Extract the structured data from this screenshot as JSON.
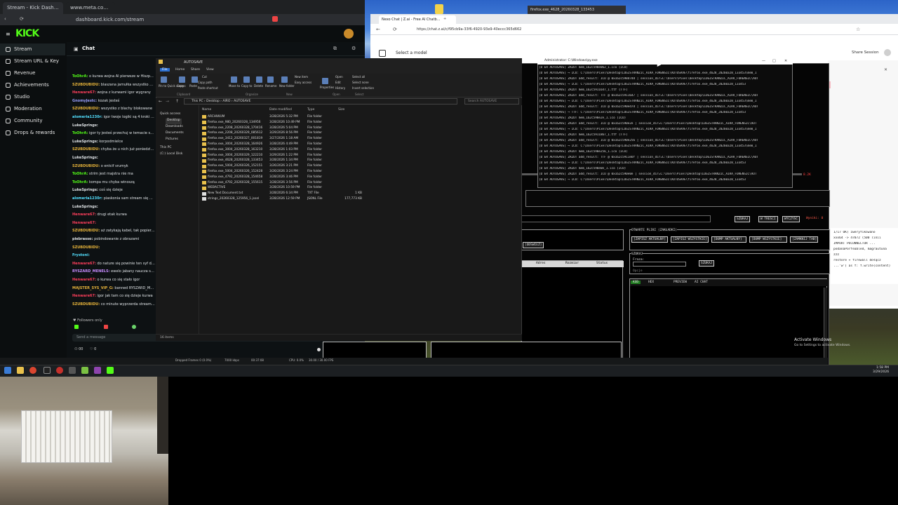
{
  "kick": {
    "tabs": [
      "Stream - Kick Dashboard",
      "www.meta.com/..."
    ],
    "url": "dashboard.kick.com/stream",
    "logo": "KICK",
    "nav": [
      "Stream",
      "Stream URL & Key",
      "Revenue",
      "Achievements",
      "Studio",
      "Moderation",
      "Community",
      "Drops & rewards"
    ],
    "chat_title": "Chat",
    "messages": [
      {
        "user": "ToOhrA:",
        "text": "o kurwa wojna Al pierwsze w Hiszp...",
        "color": "#53fc18"
      },
      {
        "user": "SZUBDUBIDU:",
        "text": "blaszana jamułka wszystko przech...",
        "color": "#e6b33a"
      },
      {
        "user": "Henware67:",
        "text": "wojna z kurwami igor wygrany",
        "color": "#ff3f5c"
      },
      {
        "user": "GnomyJestc:",
        "text": "kozak jesteś",
        "color": "#9aa0ff"
      },
      {
        "user": "SZUBDUBIDU:",
        "text": "wszystko z blachy blokowane",
        "color": "#e6b33a"
      },
      {
        "user": "alomeria1230r:",
        "text": "igor twoje logiki są 4 kroki prze...",
        "color": "#53e0ff"
      },
      {
        "user": "LukeSprings:",
        "text": "",
        "color": "#dfe3e6"
      },
      {
        "user": "ToOhrA:",
        "text": "igor ty jesteś przechuj w temacie s...",
        "color": "#53fc18"
      },
      {
        "user": "LukeSprings:",
        "text": "korpodmielce",
        "color": "#dfe3e6"
      },
      {
        "user": "SZUBDUBIDU:",
        "text": "chyba że u nich już poniedziałek i z...",
        "color": "#e6b33a"
      },
      {
        "user": "LukeSprings:",
        "text": "",
        "color": "#dfe3e6"
      },
      {
        "user": "SZUBDUBIDU:",
        "text": "o entcif srumyk",
        "color": "#e6b33a"
      },
      {
        "user": "ToOhrA:",
        "text": "strim jest majstra nie ma",
        "color": "#53fc18"
      },
      {
        "user": "ToOhrA:",
        "text": "kompa mu chyba winoszą",
        "color": "#53fc18"
      },
      {
        "user": "LukeSprings:",
        "text": "coś się dzieje",
        "color": "#dfe3e6"
      },
      {
        "user": "alomeria1230r:",
        "text": "piaskonia sam stream się wiac",
        "color": "#53e0ff"
      },
      {
        "user": "LukeSprings:",
        "text": "",
        "color": "#dfe3e6"
      },
      {
        "user": "Henware67:",
        "text": "drugi etak kurwa",
        "color": "#ff3f5c"
      },
      {
        "user": "Henware67:",
        "text": "",
        "color": "#ff3f5c"
      },
      {
        "user": "SZUBDUBIDU:",
        "text": "aż zatykają kabel, tak popierdaląś",
        "color": "#e6b33a"
      },
      {
        "user": "piebrasso:",
        "text": "pobindowanie z obrazami",
        "color": "#dfe3e6"
      },
      {
        "user": "SZUBDUBIDU:",
        "text": "",
        "color": "#e6b33a"
      },
      {
        "user": "Frystoni:",
        "text": "",
        "color": "#53e0ff"
      },
      {
        "user": "Henware67:",
        "text": "do nature się powinie ten syf doszał",
        "color": "#ff3f5c"
      },
      {
        "user": "RYSZARD_MENELS:",
        "text": "ewelo jabany naucza się kompu",
        "color": "#c78cff"
      },
      {
        "user": "Henware67:",
        "text": "o kurwa co się stało igor",
        "color": "#ff3f5c"
      },
      {
        "user": "MAJSTER_SYS_VIP_G:",
        "text": "banned RYSZARD_MENEL5",
        "color": "#e6b33a"
      },
      {
        "user": "Henware67:",
        "text": "igor jak tam co się dzieje kurwa",
        "color": "#ff3f5c"
      },
      {
        "user": "SZUBDUBIDU:",
        "text": "co minute wyprzerda streama igor...",
        "color": "#e6b33a"
      }
    ],
    "followers_only": "Followers only",
    "send_placeholder": "Send a message",
    "viewer_count": "00",
    "obs_status": [
      "Dropped Frames 0 (0.0%)",
      "7000 kbps",
      "00:37:08",
      "CPU: 0.0%",
      "30.00 / 30.00 FPS"
    ]
  },
  "ai_browser": {
    "tabs": [
      "Nexo Chat | Z.ai - Free AI Chatb...",
      "firefox.exe_4628_20260328_133453"
    ],
    "url": "https://chat.z.ai/c/f95cb9a-33f6-4920-93e9-40eccc365d662",
    "model_select": "Select a model",
    "share": "Share Session"
  },
  "console": {
    "title": "Administrator: C:\\Windows\\py.exe",
    "lines": [
      "[D ER AUTOSAVE] ZRZUT mem_162c598e062_1.ico (ICO)",
      "[D ER AUTOSAVE] ⟶ ICO: C:\\Users\\Pixel\\Desktop\\LOGISTRANZIC_AIRA_FORENSIC\\AUTOSAVE\\firefox.exe_4628_20260328_133453\\mem_1",
      "[D ER AUTOSAVE] ZRZUT add_result: ICO @ 0x162c598d7dd | session_dir=C:\\Users\\Pixel\\Desktop\\LOGISTRANZIC_AIRA_FORENSIC\\AUT",
      "[D ER AUTOSAVE] ⟶ ICO: C:\\Users\\Pixel\\Desktop\\LOGISTRANZIC_AIRA_FORENSIC\\AUTOSAVE\\firefox.exe_4628_20260328_133453",
      "[D ER AUTOSAVE] ZRZUT mem_162c5911647_1.ttf (TTF)",
      "[D ER AUTOSAVE] ZRZUT add_result: TTF @ 0x162c5911647 | session_dir=C:\\Users\\Pixel\\Desktop\\LOGISTRANZIC_AIRA_FORENSIC\\AUT",
      "[D ER AUTOSAVE] ⟶ ICO: C:\\Users\\Pixel\\Desktop\\LOGISTRANZIC_AIRA_FORENSIC\\AUTOSAVE\\firefox.exe_4628_20260328_133453\\mem_1",
      "[D ER AUTOSAVE] ZRZUT add_result: ICO @ 0x162c590ed7d | session_dir=C:\\Users\\Pixel\\Desktop\\LOGISTRANZIC_AIRA_FORENSIC\\AUT",
      "[D ER AUTOSAVE] ⟶ TTF: C:\\Users\\Pixel\\Desktop\\LOGISTRANZIC_AIRA_FORENSIC\\AUTOSAVE\\firefox.exe_4628_20260328_133453",
      "[D ER AUTOSAVE] ZRZUT mem_162c590e2e_1.ico (ICO)",
      "[D ER AUTOSAVE] ZRZUT add_result: ICO @ 0x162c590e2e | session_dir=C:\\Users\\Pixel\\Desktop\\LOGISTRANZIC_AIRA_FORENSIC\\AUT",
      "[D ER AUTOSAVE] ⟶ ICO: C:\\Users\\Pixel\\Desktop\\LOGISTRANZIC_AIRA_FORENSIC\\AUTOSAVE\\firefox.exe_4628_20260328_133453\\mem_1",
      "[D ER AUTOSAVE] ZRZUT mem_162c5911867_1.ttf (TTF)",
      "[D ER AUTOSAVE] ZRZUT add_result: ICO @ 0x162c590e256 | session_dir=C:\\Users\\Pixel\\Desktop\\LOGISTRANZIC_AIRA_FORENSIC\\AUT",
      "[D ER AUTOSAVE] ⟶ ICO: C:\\Users\\Pixel\\Desktop\\LOGISTRANZIC_AIRA_FORENSIC\\AUTOSAVE\\firefox.exe_4628_20260328_133453\\mem_1",
      "[D ER AUTOSAVE] ZRZUT mem_162c590e256_1.ico (ICO)",
      "[D ER AUTOSAVE] ZRZUT add_result: TTF @ 0x162c5911ebf | session_dir=C:\\Users\\Pixel\\Desktop\\LOGISTRANZIC_AIRA_FORENSIC\\AUT",
      "[D ER AUTOSAVE] ⟶ ICO: C:\\Users\\Pixel\\Desktop\\LOGISTRANZIC_AIRA_FORENSIC\\AUTOSAVE\\firefox.exe_4628_20260328_133453",
      "[D ER AUTOSAVE] ZRZUT mem_162c590e0e_1.ico (ICO)",
      "[D ER AUTOSAVE] ZRZUT add_result: ICO @ 0x162c590e0e | session_dir=C:\\Users\\Pixel\\Desktop\\LOGISTRANZIC_AIRA_FORENSIC\\AUT",
      "[D ER AUTOSAVE] ⟶ ICO: C:\\Users\\Pixel\\Desktop\\LOGISTRANZIC_AIRA_FORENSIC\\AUTOSAVE\\firefox.exe_4628_20260328_133453"
    ]
  },
  "explorer": {
    "title": "AUTOSAVE",
    "menu": [
      "File",
      "Home",
      "Share",
      "View"
    ],
    "ribbon": [
      "Pin to Quick access",
      "Copy",
      "Paste",
      "Cut",
      "Copy path",
      "Paste shortcut",
      "Move to",
      "Copy to",
      "Delete",
      "Rename",
      "New folder",
      "New item",
      "Easy access",
      "Properties",
      "Open",
      "Edit",
      "History",
      "Select all",
      "Select none",
      "Invert selection"
    ],
    "ribbon_groups": [
      "Clipboard",
      "Organize",
      "New",
      "Open",
      "Select"
    ],
    "path": [
      "This PC",
      "Desktop",
      "AIRO",
      "AUTOSAVE"
    ],
    "search_placeholder": "Search AUTOSAVE",
    "nav": [
      "Quick access",
      "Desktop",
      "Downloads",
      "Documents",
      "Pictures",
      "This PC",
      "(C:) Local Disk"
    ],
    "columns": [
      "Name",
      "Date modified",
      "Type",
      "Size"
    ],
    "rows": [
      {
        "name": "ARCHIWUM",
        "date": "3/28/2026 5:32 PM",
        "type": "File folder",
        "size": ""
      },
      {
        "name": "firefox.exe_980_20260328_134956",
        "date": "3/28/2026 10:49 PM",
        "type": "File folder",
        "size": ""
      },
      {
        "name": "firefox.exe_2208_20260328_170416",
        "date": "3/28/2026 5:04 PM",
        "type": "File folder",
        "size": ""
      },
      {
        "name": "firefox.exe_2208_20260329_085612",
        "date": "3/29/2026 8:56 PM",
        "type": "File folder",
        "size": ""
      },
      {
        "name": "firefox.exe_3412_20260327_001819",
        "date": "3/27/2026 1:18 AM",
        "type": "File folder",
        "size": ""
      },
      {
        "name": "firefox.exe_3004_20260328_164926",
        "date": "3/28/2026 4:49 PM",
        "type": "File folder",
        "size": ""
      },
      {
        "name": "firefox.exe_3004_20260328_163210",
        "date": "3/28/2026 1:03 PM",
        "type": "File folder",
        "size": ""
      },
      {
        "name": "firefox.exe_3004_20260329_122210",
        "date": "3/29/2026 1:22 PM",
        "type": "File folder",
        "size": ""
      },
      {
        "name": "firefox.exe_4628_20260328_133453",
        "date": "3/28/2026 1:34 PM",
        "type": "File folder",
        "size": ""
      },
      {
        "name": "firefox.exe_5004_20260326_152151",
        "date": "3/26/2026 3:21 PM",
        "type": "File folder",
        "size": ""
      },
      {
        "name": "firefox.exe_5004_20260326_152428",
        "date": "3/26/2026 3:24 PM",
        "type": "File folder",
        "size": ""
      },
      {
        "name": "firefox.exe_4792_20260328_154658",
        "date": "3/28/2026 3:46 PM",
        "type": "File folder",
        "size": ""
      },
      {
        "name": "firefox.exe_4792_20260328_155615",
        "date": "3/28/2026 3:56 PM",
        "type": "File folder",
        "size": ""
      },
      {
        "name": "WEBACTIVE",
        "date": "3/28/2026 10:59 PM",
        "type": "File folder",
        "size": ""
      },
      {
        "name": "New Text Document.txt",
        "date": "3/28/2026 6:34 PM",
        "type": "TXT File",
        "size": "1 KB"
      },
      {
        "name": "strings_20260328_125956_1.jsonl",
        "date": "3/28/2026 12:59 PM",
        "type": "JSONL File",
        "size": "177,773 KB"
      }
    ],
    "status": "16 items"
  },
  "tool": {
    "buttons_search": [
      "SZUKAJ",
      "W TREŚCI",
      "WYCZYŚĆ"
    ],
    "status_right": "Wyniki: 0",
    "section_open": "OTWARTE PLIKI (ZAKŁADKI)",
    "buttons_open": [
      "[ZAPISZ AKTUALNY]",
      "[ZAPISZ WSZYSTKIE]",
      "[DUMP AKTUALNY]",
      "[DUMP WSZYSTKIE]",
      "[ZAMKNIJ TAB]"
    ],
    "section_find": "SZUKAJ",
    "find_label": "Fraza:",
    "find_button": "SZUKAJ",
    "option_label": "Opcje",
    "tabs": [
      "KOD",
      "HEX",
      "PREVIEW",
      "AI CHAT"
    ],
    "table_cols": [
      "Adres",
      "Rozmiar",
      "Status"
    ],
    "left_button": "[ODŚWIEŻ]",
    "tag_right": "8.2K"
  },
  "side_code": [
    "1/17 OK)  zweryfikowano",
    "xxx64 -> 47072 (500 linii",
    "IMPORT POCONNECTOR ...",
    "podanaPorfeabled, magrautuna",
    "zzz",
    "restore + firewall dołącz",
    "...'w') as f: f.write(content)"
  ],
  "desktop_notice": {
    "activate": "Activate Windows",
    "activate_sub": "Go to Settings to activate Windows."
  },
  "clock": [
    "1:58 PM",
    "3/29/2026"
  ]
}
